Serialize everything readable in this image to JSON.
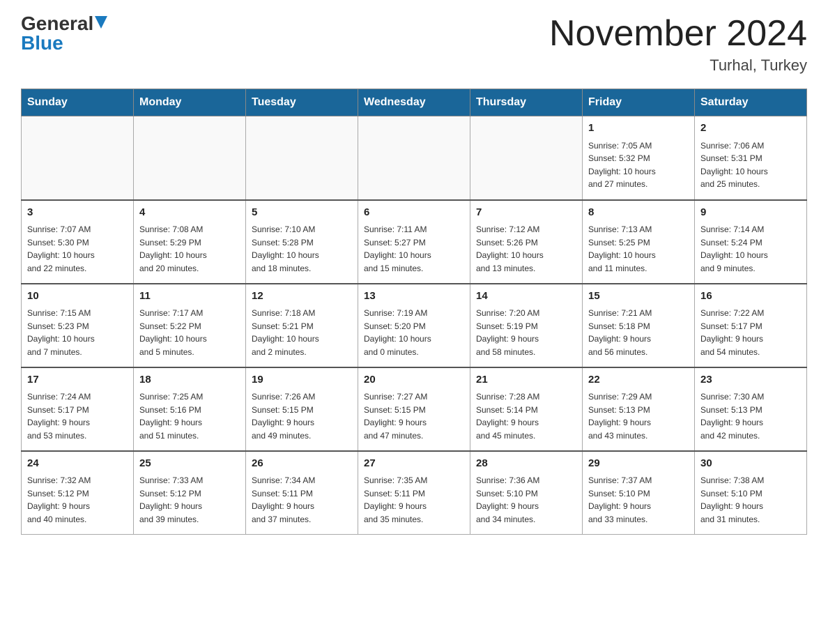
{
  "logo": {
    "general": "General",
    "blue": "Blue"
  },
  "title": "November 2024",
  "location": "Turhal, Turkey",
  "days_of_week": [
    "Sunday",
    "Monday",
    "Tuesday",
    "Wednesday",
    "Thursday",
    "Friday",
    "Saturday"
  ],
  "weeks": [
    [
      {
        "day": "",
        "info": ""
      },
      {
        "day": "",
        "info": ""
      },
      {
        "day": "",
        "info": ""
      },
      {
        "day": "",
        "info": ""
      },
      {
        "day": "",
        "info": ""
      },
      {
        "day": "1",
        "info": "Sunrise: 7:05 AM\nSunset: 5:32 PM\nDaylight: 10 hours\nand 27 minutes."
      },
      {
        "day": "2",
        "info": "Sunrise: 7:06 AM\nSunset: 5:31 PM\nDaylight: 10 hours\nand 25 minutes."
      }
    ],
    [
      {
        "day": "3",
        "info": "Sunrise: 7:07 AM\nSunset: 5:30 PM\nDaylight: 10 hours\nand 22 minutes."
      },
      {
        "day": "4",
        "info": "Sunrise: 7:08 AM\nSunset: 5:29 PM\nDaylight: 10 hours\nand 20 minutes."
      },
      {
        "day": "5",
        "info": "Sunrise: 7:10 AM\nSunset: 5:28 PM\nDaylight: 10 hours\nand 18 minutes."
      },
      {
        "day": "6",
        "info": "Sunrise: 7:11 AM\nSunset: 5:27 PM\nDaylight: 10 hours\nand 15 minutes."
      },
      {
        "day": "7",
        "info": "Sunrise: 7:12 AM\nSunset: 5:26 PM\nDaylight: 10 hours\nand 13 minutes."
      },
      {
        "day": "8",
        "info": "Sunrise: 7:13 AM\nSunset: 5:25 PM\nDaylight: 10 hours\nand 11 minutes."
      },
      {
        "day": "9",
        "info": "Sunrise: 7:14 AM\nSunset: 5:24 PM\nDaylight: 10 hours\nand 9 minutes."
      }
    ],
    [
      {
        "day": "10",
        "info": "Sunrise: 7:15 AM\nSunset: 5:23 PM\nDaylight: 10 hours\nand 7 minutes."
      },
      {
        "day": "11",
        "info": "Sunrise: 7:17 AM\nSunset: 5:22 PM\nDaylight: 10 hours\nand 5 minutes."
      },
      {
        "day": "12",
        "info": "Sunrise: 7:18 AM\nSunset: 5:21 PM\nDaylight: 10 hours\nand 2 minutes."
      },
      {
        "day": "13",
        "info": "Sunrise: 7:19 AM\nSunset: 5:20 PM\nDaylight: 10 hours\nand 0 minutes."
      },
      {
        "day": "14",
        "info": "Sunrise: 7:20 AM\nSunset: 5:19 PM\nDaylight: 9 hours\nand 58 minutes."
      },
      {
        "day": "15",
        "info": "Sunrise: 7:21 AM\nSunset: 5:18 PM\nDaylight: 9 hours\nand 56 minutes."
      },
      {
        "day": "16",
        "info": "Sunrise: 7:22 AM\nSunset: 5:17 PM\nDaylight: 9 hours\nand 54 minutes."
      }
    ],
    [
      {
        "day": "17",
        "info": "Sunrise: 7:24 AM\nSunset: 5:17 PM\nDaylight: 9 hours\nand 53 minutes."
      },
      {
        "day": "18",
        "info": "Sunrise: 7:25 AM\nSunset: 5:16 PM\nDaylight: 9 hours\nand 51 minutes."
      },
      {
        "day": "19",
        "info": "Sunrise: 7:26 AM\nSunset: 5:15 PM\nDaylight: 9 hours\nand 49 minutes."
      },
      {
        "day": "20",
        "info": "Sunrise: 7:27 AM\nSunset: 5:15 PM\nDaylight: 9 hours\nand 47 minutes."
      },
      {
        "day": "21",
        "info": "Sunrise: 7:28 AM\nSunset: 5:14 PM\nDaylight: 9 hours\nand 45 minutes."
      },
      {
        "day": "22",
        "info": "Sunrise: 7:29 AM\nSunset: 5:13 PM\nDaylight: 9 hours\nand 43 minutes."
      },
      {
        "day": "23",
        "info": "Sunrise: 7:30 AM\nSunset: 5:13 PM\nDaylight: 9 hours\nand 42 minutes."
      }
    ],
    [
      {
        "day": "24",
        "info": "Sunrise: 7:32 AM\nSunset: 5:12 PM\nDaylight: 9 hours\nand 40 minutes."
      },
      {
        "day": "25",
        "info": "Sunrise: 7:33 AM\nSunset: 5:12 PM\nDaylight: 9 hours\nand 39 minutes."
      },
      {
        "day": "26",
        "info": "Sunrise: 7:34 AM\nSunset: 5:11 PM\nDaylight: 9 hours\nand 37 minutes."
      },
      {
        "day": "27",
        "info": "Sunrise: 7:35 AM\nSunset: 5:11 PM\nDaylight: 9 hours\nand 35 minutes."
      },
      {
        "day": "28",
        "info": "Sunrise: 7:36 AM\nSunset: 5:10 PM\nDaylight: 9 hours\nand 34 minutes."
      },
      {
        "day": "29",
        "info": "Sunrise: 7:37 AM\nSunset: 5:10 PM\nDaylight: 9 hours\nand 33 minutes."
      },
      {
        "day": "30",
        "info": "Sunrise: 7:38 AM\nSunset: 5:10 PM\nDaylight: 9 hours\nand 31 minutes."
      }
    ]
  ]
}
